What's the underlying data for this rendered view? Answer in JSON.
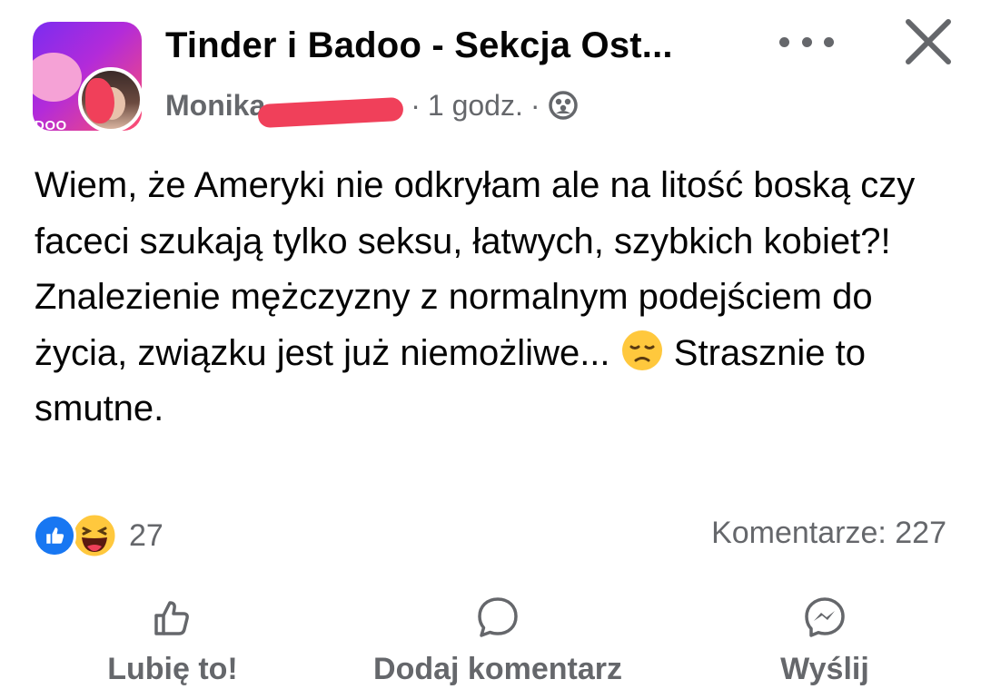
{
  "post": {
    "group_name": "Tinder i Badoo - Sekcja Ost...",
    "group_avatar_text": "DOO",
    "author": "Monika",
    "time": "1 godz.",
    "privacy_icon": "group-members-icon",
    "body_line1": "Wiem, że Ameryki nie odkryłam ale na litość boską czy faceci szukają tylko seksu, łatwych, szybkich kobiet?!",
    "body_line2_a": "Znalezienie mężczyzny z normalnym podejściem do życia, związku jest już niemożliwe... ",
    "body_emoji": "disappointed-face-emoji",
    "body_line2_b": " Strasznie to smutne."
  },
  "reactions": {
    "icons": [
      "like-icon",
      "haha-icon"
    ],
    "count": "27",
    "comments_label": "Komentarze: 227"
  },
  "actions": {
    "like_label": "Lubię to!",
    "comment_label": "Dodaj komentarz",
    "share_label": "Wyślij"
  },
  "colors": {
    "text": "#050505",
    "muted": "#65676b",
    "like_blue": "#1877f2",
    "redaction": "#f0405a"
  }
}
